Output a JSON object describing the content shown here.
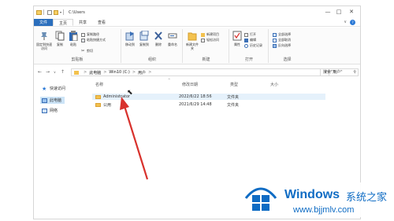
{
  "titlebar": {
    "path": "C:\\Users",
    "minimize": "—",
    "maximize": "□",
    "close": "✕"
  },
  "ribbon_tabs": {
    "file": "文件",
    "home": "主页",
    "share": "共享",
    "view": "查看",
    "help": "?"
  },
  "ribbon": {
    "clipboard": {
      "pin": "固定到快速访问",
      "copy": "复制",
      "paste": "粘贴",
      "copy_path": "复制路径",
      "paste_shortcut": "粘贴快捷方式",
      "cut": "剪切",
      "label": "剪贴板"
    },
    "organize": {
      "move_to": "移动到",
      "copy_to": "复制到",
      "delete": "删除",
      "rename": "重命名",
      "label": "组织"
    },
    "new": {
      "new_folder": "新建文件夹",
      "new_item": "新建项目",
      "easy_access": "轻松访问",
      "label": "新建"
    },
    "open": {
      "properties": "属性",
      "open": "打开",
      "edit": "编辑",
      "history": "历史记录",
      "label": "打开"
    },
    "select": {
      "select_all": "全部选择",
      "select_none": "全部取消",
      "invert": "反向选择",
      "label": "选择"
    }
  },
  "address": {
    "back": "←",
    "forward": "→",
    "recent": "∨",
    "up": "↑",
    "crumbs": [
      "此电脑",
      "Win10 (C:)",
      "用户"
    ],
    "separator": ">",
    "dropdown": "∨",
    "refresh": "↻",
    "search_placeholder": "搜索\"用户\""
  },
  "nav_pane": {
    "quick_access": "快速访问",
    "this_pc": "此电脑",
    "network": "网络"
  },
  "file_list": {
    "columns": {
      "name": "名称",
      "date": "修改日期",
      "type": "类型",
      "size": "大小"
    },
    "rows": [
      {
        "name": "Administrator",
        "date": "2022/6/22 18:56",
        "type": "文件夹"
      },
      {
        "name": "公用",
        "date": "2021/6/29 14:48",
        "type": "文件夹"
      }
    ]
  },
  "watermark": {
    "title": "Windows",
    "cn": "系统之家",
    "url": "www.bjjmlv.com"
  },
  "colors": {
    "accent": "#2b6fbd",
    "folder": "#f3c24f",
    "arrow": "#d8322d",
    "watermark": "#0f6cc4"
  }
}
